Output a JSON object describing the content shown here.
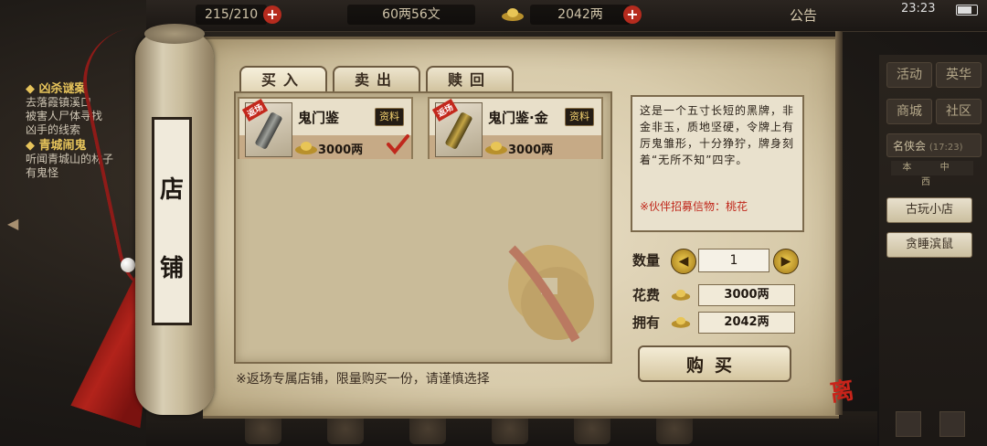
{
  "topbar": {
    "stamina": "215/210",
    "copper": "60两56文",
    "silver": "2042两",
    "announce": "公告",
    "clock": "23:23"
  },
  "quests": [
    {
      "title": "凶杀谜案",
      "desc": [
        "去落霞镇溪口",
        "被害人尸体寻找",
        "凶手的线索"
      ]
    },
    {
      "title": "青城闹鬼",
      "desc": [
        "听闻青城山的林子",
        "有鬼怪"
      ]
    }
  ],
  "side_menu": {
    "buttons": [
      "活动",
      "英华",
      "商城",
      "社区"
    ],
    "event": "名侠会",
    "event_time": "(17:23)",
    "tri": "本 中 西",
    "shops": [
      "古玩小店",
      "贪睡滨鼠"
    ]
  },
  "shop": {
    "title_chars": [
      "店",
      "铺"
    ],
    "tabs": [
      "买入",
      "卖出",
      "赎回"
    ],
    "items": [
      {
        "badge": "返场",
        "name": "鬼门鉴",
        "info": "资料",
        "price": "3000两",
        "selected": true
      },
      {
        "badge": "返场",
        "name": "鬼门鉴·金",
        "info": "资料",
        "price": "3000两",
        "selected": false
      }
    ],
    "description": "这是一个五寸长短的黑牌，非金非玉，质地坚硬，令牌上有厉鬼雏形，十分狰狞，牌身刻着“无所不知”四字。",
    "partner_note": "※伙伴招募信物：桃花",
    "qty_label": "数量",
    "qty_value": "1",
    "cost_label": "花费",
    "cost_value": "3000两",
    "own_label": "拥有",
    "own_value": "2042两",
    "buy_label": "购买",
    "footnote": "※返场专属店铺，限量购买一份，请谨慎选择"
  },
  "colors": {
    "accent_red": "#c0281c",
    "gold": "#e7c45b"
  }
}
